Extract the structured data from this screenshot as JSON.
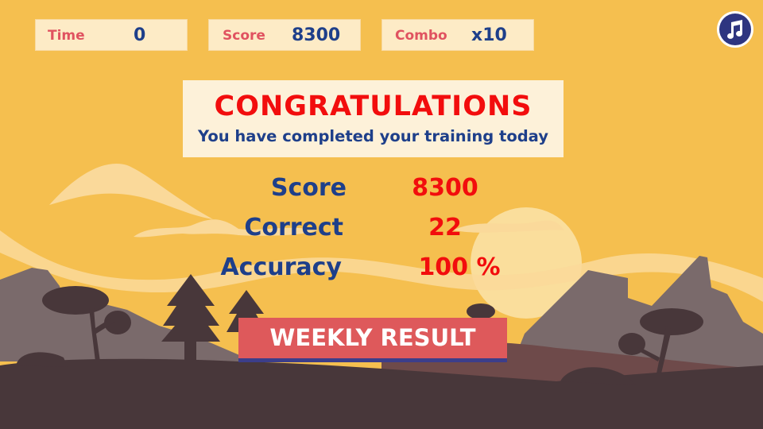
{
  "hud": {
    "time": {
      "label": "Time",
      "value": "0"
    },
    "score": {
      "label": "Score",
      "value": "8300"
    },
    "combo": {
      "label": "Combo",
      "value": "x10"
    }
  },
  "music_button": {
    "icon": "music-note-icon"
  },
  "congrats": {
    "title": "CONGRATULATIONS",
    "subtitle": "You have completed your training today"
  },
  "results": [
    {
      "label": "Score",
      "value": "8300"
    },
    {
      "label": "Correct",
      "value": "22"
    },
    {
      "label": "Accuracy",
      "value": "100 %"
    }
  ],
  "weekly_button": {
    "label": "WEEKLY RESULT"
  },
  "colors": {
    "sky": "#f5bf4f",
    "panel": "#fdebc6",
    "label_red": "#e05260",
    "value_blue": "#1e3f8a",
    "highlight_red": "#f20d0d",
    "button_red": "#de595b",
    "button_shadow": "#3c3e8a",
    "ground": "#48373a",
    "mountain": "#7a6a6b"
  }
}
